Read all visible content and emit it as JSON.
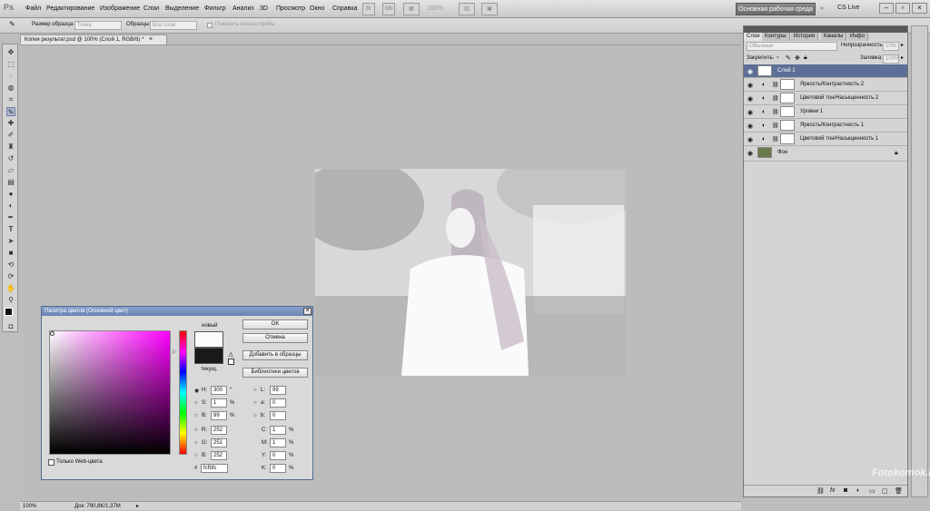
{
  "menubar": {
    "logo": "Ps",
    "items": [
      "Файл",
      "Редактирование",
      "Изображение",
      "Слои",
      "Выделение",
      "Фильтр",
      "Анализ",
      "3D",
      "Просмотр",
      "Окно",
      "Справка"
    ],
    "zoom": "100%",
    "workspace": "Основная рабочая среда",
    "cs_live": "CS Live"
  },
  "options": {
    "sample_size_label": "Размер образца:",
    "sample_size_value": "Точка",
    "samples_label": "Образцы:",
    "samples_value": "Все слои",
    "show_ring": "Показать кольцо пробы"
  },
  "document": {
    "tab": "Копия результат.psd @ 100% (Слой 1, RGB/8) *",
    "zoom": "100%",
    "doc_size": "Док: 790,8K/1,37M"
  },
  "layers": {
    "tabs": [
      "Слои",
      "Контуры",
      "История",
      "Каналы",
      "Инфо"
    ],
    "blend_mode": "Обычные",
    "opacity_label": "Непрозрачность:",
    "opacity_value": "10%",
    "lock_label": "Закрепить:",
    "fill_label": "Заливка:",
    "fill_value": "100%",
    "items": [
      {
        "name": "Слой 1"
      },
      {
        "name": "Яркость/Контрастность 2"
      },
      {
        "name": "Цветовой тон/Насыщенность 2"
      },
      {
        "name": "Уровни 1"
      },
      {
        "name": "Яркость/Контрастность 1"
      },
      {
        "name": "Цветовой тон/Насыщенность 1"
      },
      {
        "name": "Фон"
      }
    ]
  },
  "picker": {
    "title": "Палитра цветов (Основной цвет)",
    "new_label": "новый",
    "current_label": "текущ.",
    "ok": "OK",
    "cancel": "Отмена",
    "add_swatches": "Добавить в образцы",
    "libraries": "Библиотеки цветов",
    "web_only": "Только Web-цвета",
    "new_color": "#fcfbfc",
    "current_color": "#1a1a1a",
    "fields": {
      "h_label": "H:",
      "h": "300",
      "h_unit": "°",
      "s_label": "S:",
      "s": "1",
      "s_unit": "%",
      "b_label": "B:",
      "b": "99",
      "b_unit": "%",
      "r_label": "R:",
      "r": "252",
      "g_label": "G:",
      "g": "251",
      "bl_label": "B:",
      "bl": "252",
      "l_label": "L:",
      "l": "99",
      "a_label": "a:",
      "a": "0",
      "bb_label": "b:",
      "bb": "0",
      "c_label": "C:",
      "c": "1",
      "c_unit": "%",
      "m_label": "M:",
      "m": "1",
      "m_unit": "%",
      "y_label": "Y:",
      "y": "0",
      "y_unit": "%",
      "k_label": "K:",
      "k": "0",
      "k_unit": "%",
      "hex_label": "#",
      "hex": "fcfbfc"
    }
  },
  "watermark": "Fotokomok.ru"
}
